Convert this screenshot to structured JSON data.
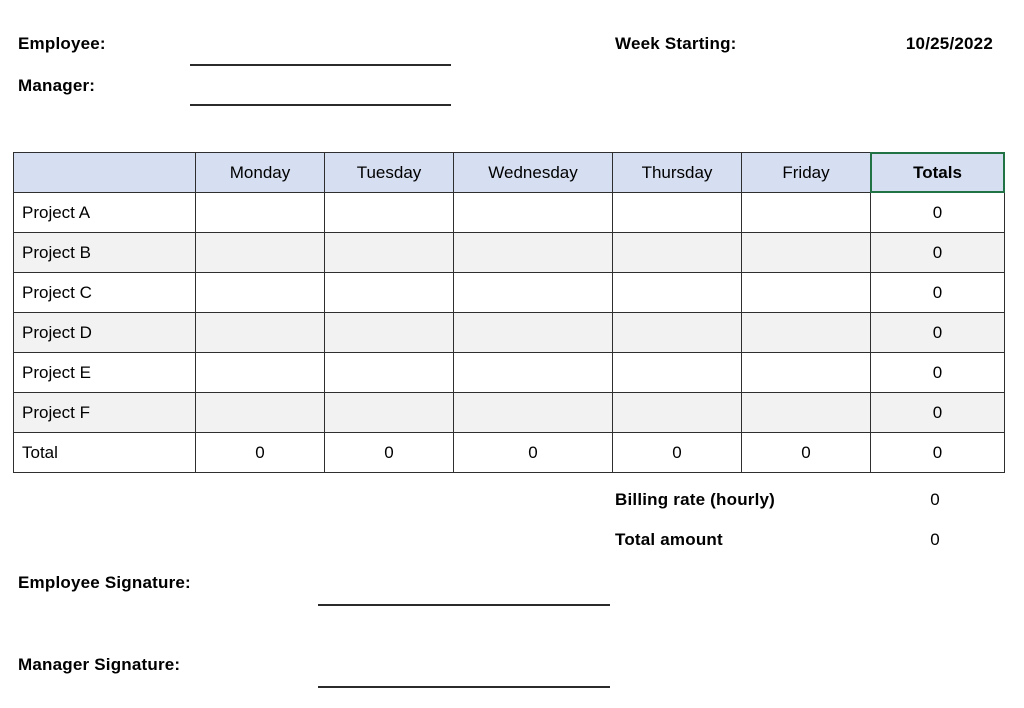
{
  "header": {
    "employee_label": "Employee:",
    "manager_label": "Manager:",
    "week_starting_label": "Week Starting:",
    "week_starting_value": "10/25/2022"
  },
  "table": {
    "columns": [
      "",
      "Monday",
      "Tuesday",
      "Wednesday",
      "Thursday",
      "Friday",
      "Totals"
    ],
    "rows": [
      {
        "label": "Project A",
        "monday": "",
        "tuesday": "",
        "wednesday": "",
        "thursday": "",
        "friday": "",
        "total": "0"
      },
      {
        "label": "Project B",
        "monday": "",
        "tuesday": "",
        "wednesday": "",
        "thursday": "",
        "friday": "",
        "total": "0"
      },
      {
        "label": "Project C",
        "monday": "",
        "tuesday": "",
        "wednesday": "",
        "thursday": "",
        "friday": "",
        "total": "0"
      },
      {
        "label": "Project D",
        "monday": "",
        "tuesday": "",
        "wednesday": "",
        "thursday": "",
        "friday": "",
        "total": "0"
      },
      {
        "label": "Project E",
        "monday": "",
        "tuesday": "",
        "wednesday": "",
        "thursday": "",
        "friday": "",
        "total": "0"
      },
      {
        "label": "Project F",
        "monday": "",
        "tuesday": "",
        "wednesday": "",
        "thursday": "",
        "friday": "",
        "total": "0"
      }
    ],
    "total_row": {
      "label": "Total",
      "monday": "0",
      "tuesday": "0",
      "wednesday": "0",
      "thursday": "0",
      "friday": "0",
      "total": "0"
    },
    "header_fill": "#d6dff2",
    "band_fill": "#f2f2f2",
    "active_cell_outline": "#217346",
    "active_cell": "Totals"
  },
  "billing": {
    "rate_label": "Billing rate (hourly)",
    "rate_value": "0",
    "amount_label": "Total amount",
    "amount_value": "0"
  },
  "signatures": {
    "employee_label": "Employee Signature:",
    "manager_label": "Manager Signature:"
  }
}
